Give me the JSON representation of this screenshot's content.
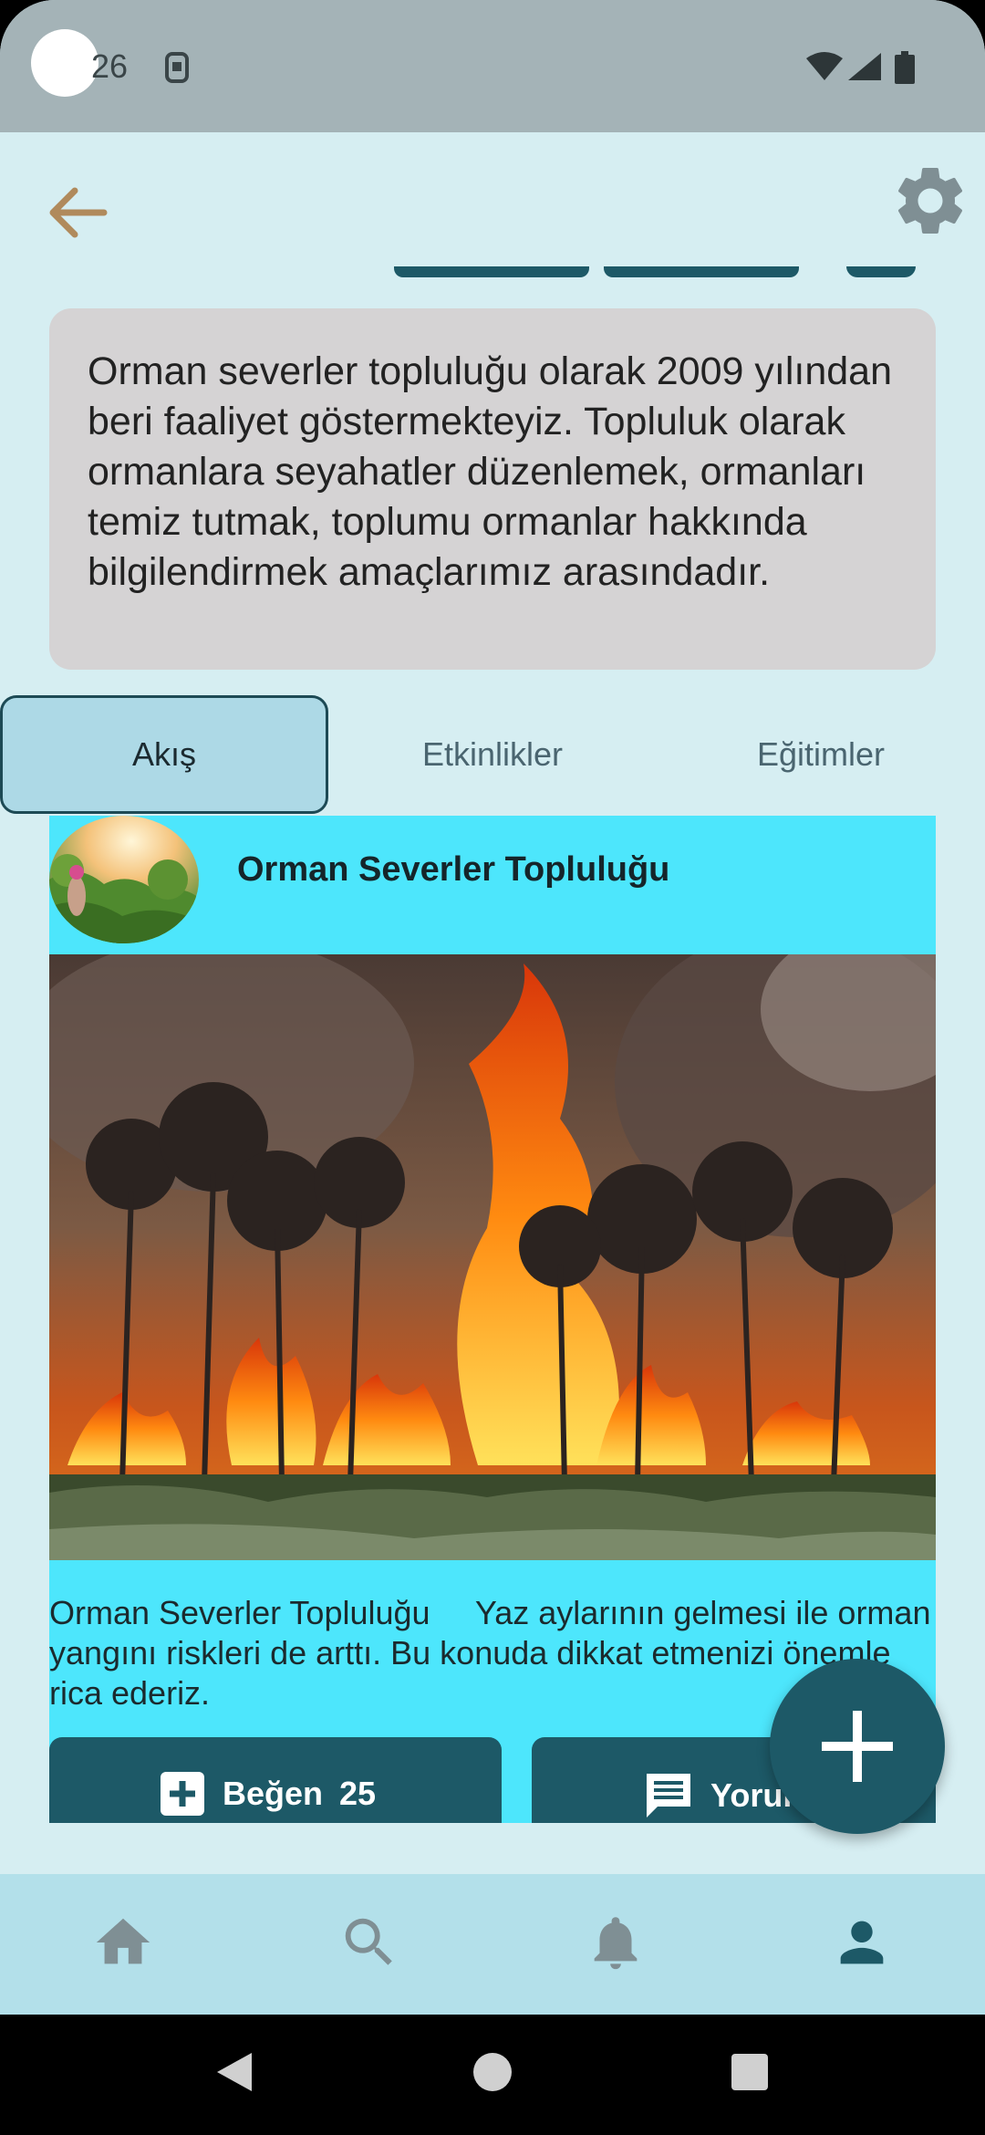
{
  "status_bar": {
    "time": "26",
    "icons": [
      "camera-cutout",
      "sim-icon",
      "wifi-icon",
      "signal-icon",
      "battery-icon"
    ]
  },
  "app_bar": {
    "back_icon": "arrow-left-icon",
    "settings_icon": "gear-icon"
  },
  "about": {
    "text": "Orman severler topluluğu olarak 2009 yılından beri faaliyet göstermekteyiz. Topluluk olarak ormanlara seyahatler düzenlemek, ormanları temiz tutmak, toplumu ormanlar hakkında bilgilendirmek amaçlarımız arasındadır."
  },
  "tabs": [
    {
      "label": "Akış",
      "active": true
    },
    {
      "label": "Etkinlikler",
      "active": false
    },
    {
      "label": "Eğitimler",
      "active": false
    }
  ],
  "post": {
    "author": "Orman Severler Topluluğu",
    "text_line1": "Orman Severler Topluluğu     Yaz aylarının gelmesi ile orman",
    "text_line2": "yangını riskleri de arttı. Bu konuda dikkat etmenizi önemle",
    "text_line3": "rica ederiz.",
    "like_label": "Beğen",
    "like_count": "25",
    "comment_label": "Yorum"
  },
  "fab": {
    "icon": "plus-icon"
  },
  "bottom_nav": [
    {
      "icon": "home-icon",
      "active": false
    },
    {
      "icon": "search-icon",
      "active": false
    },
    {
      "icon": "bell-icon",
      "active": false
    },
    {
      "icon": "person-icon",
      "active": true
    }
  ],
  "colors": {
    "background": "#d6eef2",
    "accent": "#1d5967",
    "post_background": "#4de6fc",
    "about_card": "#d5d3d4",
    "back_arrow": "#b08a5c"
  }
}
